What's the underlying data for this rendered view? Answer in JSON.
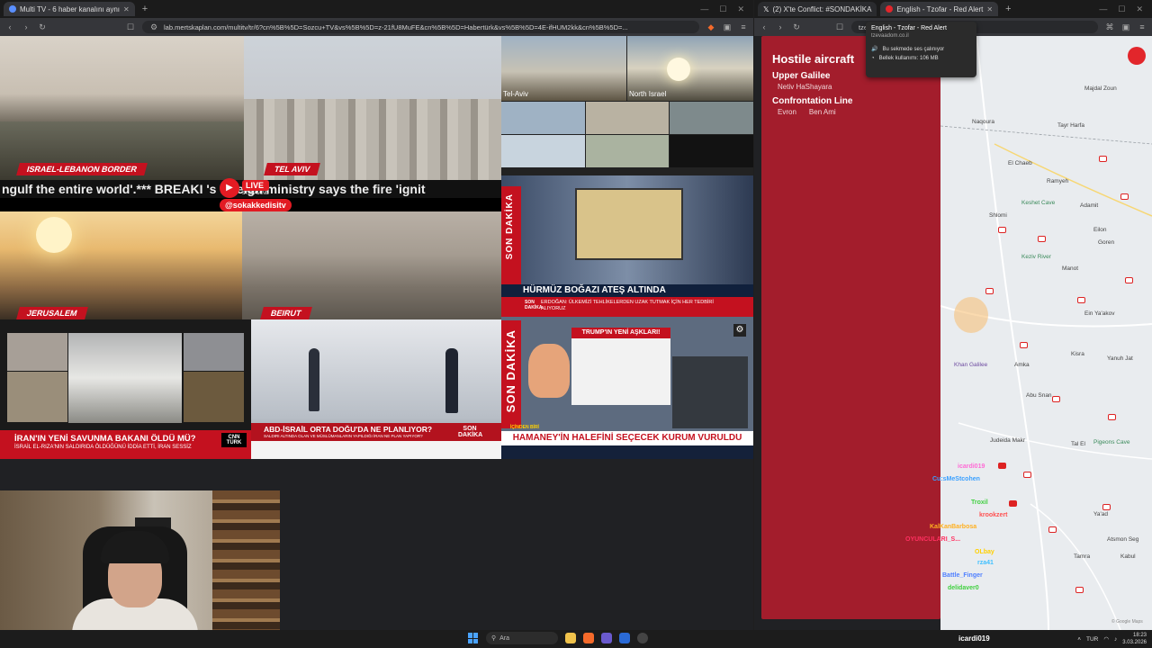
{
  "left_window": {
    "tabs": [
      {
        "label": "Multi TV - 6 haber kanalını aynı",
        "active": true
      }
    ],
    "address": "lab.mertskaplan.com/multitv/tr/6?cn%5B%5D=Sozcu+TV&vs%5B%5D=z-21fU8MuFE&cn%5B%5D=Habertürk&vs%5B%5D=4E-ifHUM2kk&cn%5B%5D=..."
  },
  "feeds": {
    "israel_lebanon": "ISRAEL-LEBANON BORDER",
    "tel_aviv": "TEL AVIV",
    "jerusalem": "JERUSALEM",
    "beirut": "BEIRUT",
    "ticker": "ngulf the entire world'.*** BREAKI          's foreign ministry says the fire 'ignit",
    "live": "LIVE",
    "live_sub": "STREAMING",
    "handle": "@sokakkedisitv",
    "cam_tel_aviv": "Tel-Aviv",
    "cam_north_israel": "North Israel",
    "ntv_son_dakika": "SON DAKİKA",
    "ntv_headline": "HÜRMÜZ BOĞAZI ATEŞ ALTINDA",
    "ntv_sub": "ERDOĞAN: ÜLKEMİZİ TEHLİKELERDEN UZAK TUTMAK İÇİN HER TEDBİRİ ALIYORUZ",
    "ntv_son": "SON DAKİKA",
    "cnn_headline": "İRAN'IN YENİ SAVUNMA BAKANI ÖLDÜ MÜ?",
    "cnn_sub": "İSRAİL EL-RIZA'NIN SALDIRIDA ÖLDÜĞÜNÜ İDDİA ETTİ, İRAN SESSİZ",
    "cnn_badge": "CNN TÜRK",
    "trt_headline": "ABD-İSRAİL ORTA DOĞU'DA NE PLANLIYOR?",
    "trt_sub": "SALDIRI ALTINDA OLAN VE MÜSLÜMANLARIN YAPILDIĞI İRAN NE PLAN YAPIYOR?",
    "trt_son": "SON DAKİKA",
    "sozcu_son_dakika": "SON DAKİKA",
    "sozcu_graphic": "TRUMP'IN YENİ AŞKLARI!",
    "sozcu_headline": "HAMANEY'İN HALEFİNİ SEÇECEK KURUM VURULDU",
    "sozcu_next": "İÇİNDEN BİRİ"
  },
  "right_window": {
    "tabs": [
      {
        "label": "(2) X'te Conflict: #SONDAKİKA",
        "active": false
      },
      {
        "label": "English - Tzofar - Red Alert",
        "active": true
      }
    ],
    "address": "tzeva..."
  },
  "tooltip": {
    "title": "English - Tzofar - Red Alert",
    "domain": "tzevaadom.co.il",
    "audio": "Bu sekmede ses çalınıyor",
    "memory": "Bellek kullanımı: 106 MB"
  },
  "alert": {
    "title": "Hostile aircraft",
    "regions": [
      {
        "name": "Upper Galilee",
        "cities": [
          "Netiv HaShayara"
        ]
      },
      {
        "name": "Confrontation Line",
        "cities": [
          "Evron",
          "Ben Ami"
        ]
      }
    ]
  },
  "map_labels": {
    "nahariya": "Nahariyya",
    "gesher": "Gesher HaZiv",
    "shlomi": "Shlomi",
    "majdal": "Majdal Zoun",
    "naqoura": "Naqoura",
    "tayr_harfa": "Tayr Harfa",
    "el_chaeb": "El Chaeb",
    "ramyeh": "Ramyeh",
    "keshet": "Keshet Cave",
    "adamit": "Adamit",
    "eilon": "Eilon",
    "kziv": "Keziv River",
    "goren": "Goren",
    "manot": "Manot",
    "ein_yakov": "Ein Ya'akov",
    "kfar_vradim": "Kfar Vradim",
    "kisra": "Kisra",
    "khan": "Khan Galilee",
    "amka": "Amka",
    "yanuh": "Yanuh Jat",
    "abu_snan": "Abu Snan",
    "judeida": "Judeida Makr",
    "tal_el": "Tal El",
    "pigeons": "Pigeons Cave",
    "tamra": "Tamra",
    "kabul": "Kabul",
    "yaad": "Ya'ad",
    "atsmon": "Atsmon Seg",
    "akko": "Acre",
    "google": "© Google Maps"
  },
  "chat": [
    {
      "user": "icardi019",
      "color": "#ff6ad5"
    },
    {
      "user": "Cu:sMeStcohen",
      "color": "#3aa0ff"
    },
    {
      "user": "Troxil",
      "color": "#40d040"
    },
    {
      "user": "krookzert",
      "color": "#ff5050"
    },
    {
      "user": "KalKanBarbosa",
      "color": "#ffb020"
    },
    {
      "user": "OYUNCULARI_S...",
      "color": "#ff3060"
    },
    {
      "user": "OLbay",
      "color": "#ffd000"
    },
    {
      "user": "rza41",
      "color": "#40c0ff"
    },
    {
      "user": "Battle_Finger",
      "color": "#5080ff"
    },
    {
      "user": "delidaver0",
      "color": "#40d040"
    }
  ],
  "taskbar": {
    "search": "Ara",
    "user": "icardi019",
    "lang": "TUR",
    "time": "18:23",
    "date": "3.03.2026"
  },
  "colors": {
    "alert_red": "#a31d2c",
    "map_bg": "#e9ecef",
    "news_red": "#c4111f"
  }
}
